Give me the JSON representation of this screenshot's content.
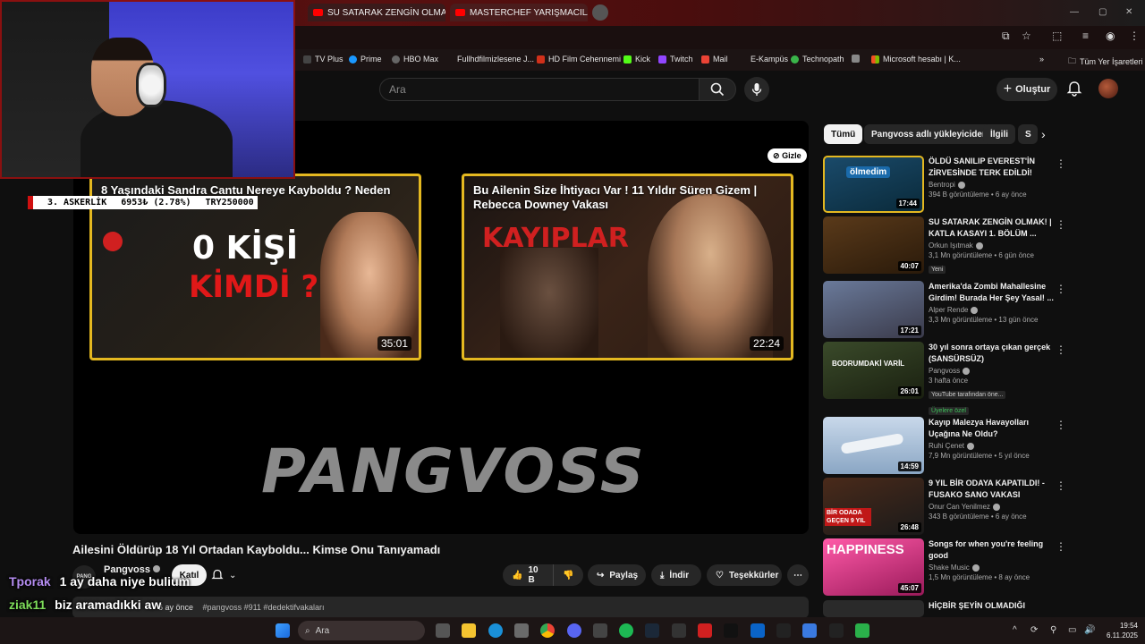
{
  "browser": {
    "tabs": [
      {
        "label": "SU SATARAK ZENGİN OLMAK! |"
      },
      {
        "label": "MASTERCHEF YARIŞMACILARIN"
      }
    ],
    "bookmarks": [
      {
        "label": "TV Plus"
      },
      {
        "label": "Prime"
      },
      {
        "label": "HBO Max"
      },
      {
        "label": "Fullhdfilmizlesene J..."
      },
      {
        "label": "HD Film Cehennemi"
      },
      {
        "label": "Kick"
      },
      {
        "label": "Twitch"
      },
      {
        "label": "Mail"
      },
      {
        "label": "E-Kampüs"
      },
      {
        "label": "Technopath"
      },
      {
        "label": "Microsoft hesabı | K..."
      },
      {
        "label": "Tüm Yer İşaretleri"
      }
    ]
  },
  "header": {
    "search_placeholder": "Ara",
    "create_label": "Oluştur"
  },
  "player": {
    "hide_label": "Gizle",
    "brand": "PANGVOSS",
    "endcards": [
      {
        "title": "8 Yaşındaki Sandra Cantu Nereye Kayboldu ? Neden",
        "overlay_line1": "0 KİŞİ",
        "overlay_line2": "KİMDİ ?",
        "duration": "35:01"
      },
      {
        "title": "Bu Ailenin Size İhtiyacı Var ! 11 Yıldır Süren Gizem | Rebecca Downey Vakası",
        "overlay_line1": "KAYIPLAR",
        "duration": "22:24"
      }
    ]
  },
  "video": {
    "title": "Ailesini Öldürüp 18 Yıl Ortadan Kayboldu... Kimse Onu Tanıyamadı",
    "channel_logo_text": "PANG",
    "channel": "Pangvoss",
    "join_label": "Katıl",
    "like_count": "10 B",
    "share_label": "Paylaş",
    "download_label": "İndir",
    "thanks_label": "Teşekkürler",
    "desc_time": "6 ay önce",
    "desc_tags": "#pangvoss #911 #dedektifvakaları"
  },
  "sidebar": {
    "chips": [
      {
        "label": "Tümü"
      },
      {
        "label": "Pangvoss adlı yükleyiciden"
      },
      {
        "label": "İlgili"
      },
      {
        "label": "S"
      }
    ],
    "recommendations": [
      {
        "title": "ÖLDÜ SANILIP EVEREST'İN ZİRVESİNDE TERK EDİLDİ!",
        "channel": "Bentropi",
        "meta": "394 B görüntüleme • 6 ay önce",
        "duration": "17:44",
        "thumb_text": "ölmedim",
        "badge": ""
      },
      {
        "title": "SU SATARAK ZENGİN OLMAK! | KATLA KASAYI 1. BÖLÜM ...",
        "channel": "Orkun Işıtmak",
        "meta": "3,1 Mn görüntüleme • 6 gün önce",
        "duration": "40:07",
        "thumb_text": "",
        "badge": "Yeni"
      },
      {
        "title": "Amerika'da Zombi Mahallesine Girdim! Burada Her Şey Yasal! ...",
        "channel": "Alper Rende",
        "meta": "3,3 Mn görüntüleme • 13 gün önce",
        "duration": "17:21",
        "thumb_text": "",
        "badge": ""
      },
      {
        "title": "30 yıl sonra ortaya çıkan gerçek (SANSÜRSÜZ)",
        "channel": "Pangvoss",
        "meta": "3 hafta önce",
        "duration": "26:01",
        "thumb_text": "BODRUMDAKİ VARİL",
        "badge": "YouTube tarafından öne...",
        "badge2": "Üyelere özel"
      },
      {
        "title": "Kayıp Malezya Havayolları Uçağına Ne Oldu?",
        "channel": "Ruhi Çenet",
        "meta": "7,9 Mn görüntüleme • 5 yıl önce",
        "duration": "14:59",
        "thumb_text": "",
        "badge": ""
      },
      {
        "title": "9 YIL BİR ODAYA KAPATILDI! - FUSAKO SANO VAKASI",
        "channel": "Onur Can Yenilmez",
        "meta": "343 B görüntüleme • 6 ay önce",
        "duration": "26:48",
        "thumb_text": "BİR ODADA GEÇEN 9 YIL",
        "badge": ""
      },
      {
        "title": "Songs for when you're feeling good",
        "channel": "Shake Music",
        "meta": "1,5 Mn görüntüleme • 8 ay önce",
        "duration": "45:07",
        "thumb_text": "HAPPINESS",
        "badge": ""
      },
      {
        "title": "HİÇBİR ŞEYİN OLMADIĞI",
        "channel": "",
        "meta": "",
        "duration": "",
        "thumb_text": "",
        "badge": ""
      }
    ]
  },
  "stream": {
    "ticker_item": "3. ASKERLİK",
    "ticker_value": "6953₺ (2.78%)",
    "ticker_goal": "TRY250000",
    "chat": [
      {
        "user": "Tporak",
        "message": "1 ay daha niye bulium",
        "color": "#b48cf0"
      },
      {
        "user": "ziak11",
        "message": "biz aramadıkki aw",
        "color": "#7ddc5a"
      }
    ]
  },
  "taskbar": {
    "search_label": "Ara",
    "time": "19:54",
    "date": "6.11.2025"
  },
  "colors": {
    "background": "#0f0f0f",
    "accent_red": "#ff0000",
    "endcard_border": "#e4b820"
  }
}
